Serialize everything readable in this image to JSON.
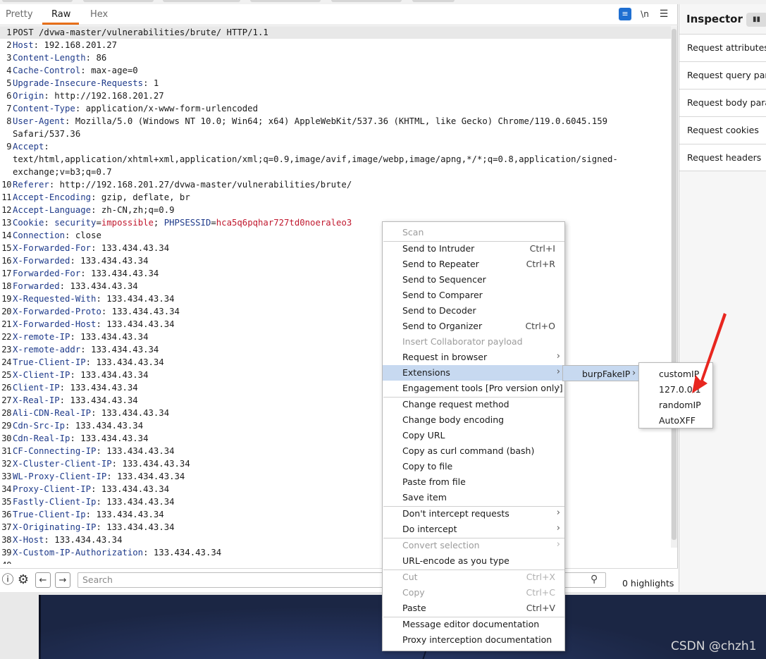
{
  "tabs": [
    {
      "label": "Pretty"
    },
    {
      "label": "Raw"
    },
    {
      "label": "Hex"
    }
  ],
  "toolbar": {
    "wrap_icon": "wrap-lines-icon",
    "newline_label": "\\n",
    "menu_icon": "hamburger-menu-icon"
  },
  "request_lines": [
    {
      "num": "1",
      "key": "",
      "value": "POST /dvwa-master/vulnerabilities/brute/ HTTP/1.1"
    },
    {
      "num": "2",
      "key": "Host",
      "value": "192.168.201.27"
    },
    {
      "num": "3",
      "key": "Content-Length",
      "value": "86"
    },
    {
      "num": "4",
      "key": "Cache-Control",
      "value": "max-age=0"
    },
    {
      "num": "5",
      "key": "Upgrade-Insecure-Requests",
      "value": "1"
    },
    {
      "num": "6",
      "key": "Origin",
      "value": "http://192.168.201.27"
    },
    {
      "num": "7",
      "key": "Content-Type",
      "value": "application/x-www-form-urlencoded"
    },
    {
      "num": "8",
      "key": "User-Agent",
      "value": "Mozilla/5.0 (Windows NT 10.0; Win64; x64) AppleWebKit/537.36 (KHTML, like Gecko) Chrome/119.0.6045.159"
    },
    {
      "num": "",
      "key": "",
      "value": "Safari/537.36"
    },
    {
      "num": "9",
      "key": "Accept",
      "value": ""
    },
    {
      "num": "",
      "key": "",
      "value": "text/html,application/xhtml+xml,application/xml;q=0.9,image/avif,image/webp,image/apng,*/*;q=0.8,application/signed-"
    },
    {
      "num": "",
      "key": "",
      "value": "exchange;v=b3;q=0.7"
    },
    {
      "num": "10",
      "key": "Referer",
      "value": "http://192.168.201.27/dvwa-master/vulnerabilities/brute/"
    },
    {
      "num": "11",
      "key": "Accept-Encoding",
      "value": "gzip, deflate, br"
    },
    {
      "num": "12",
      "key": "Accept-Language",
      "value": "zh-CN,zh;q=0.9"
    },
    {
      "num": "13",
      "key": "Cookie",
      "value": "",
      "cookies": [
        {
          "k": "security",
          "v": "impossible"
        },
        {
          "k": "PHPSESSID",
          "v": "hca5q6pqhar727td0noeraleo3"
        }
      ]
    },
    {
      "num": "14",
      "key": "Connection",
      "value": "close"
    },
    {
      "num": "15",
      "key": "X-Forwarded-For",
      "value": "133.434.43.34"
    },
    {
      "num": "16",
      "key": "X-Forwarded",
      "value": "133.434.43.34"
    },
    {
      "num": "17",
      "key": "Forwarded-For",
      "value": "133.434.43.34"
    },
    {
      "num": "18",
      "key": "Forwarded",
      "value": "133.434.43.34"
    },
    {
      "num": "19",
      "key": "X-Requested-With",
      "value": "133.434.43.34"
    },
    {
      "num": "20",
      "key": "X-Forwarded-Proto",
      "value": "133.434.43.34"
    },
    {
      "num": "21",
      "key": "X-Forwarded-Host",
      "value": "133.434.43.34"
    },
    {
      "num": "22",
      "key": "X-remote-IP",
      "value": "133.434.43.34"
    },
    {
      "num": "23",
      "key": "X-remote-addr",
      "value": "133.434.43.34"
    },
    {
      "num": "24",
      "key": "True-Client-IP",
      "value": "133.434.43.34"
    },
    {
      "num": "25",
      "key": "X-Client-IP",
      "value": "133.434.43.34"
    },
    {
      "num": "26",
      "key": "Client-IP",
      "value": "133.434.43.34"
    },
    {
      "num": "27",
      "key": "X-Real-IP",
      "value": "133.434.43.34"
    },
    {
      "num": "28",
      "key": "Ali-CDN-Real-IP",
      "value": "133.434.43.34"
    },
    {
      "num": "29",
      "key": "Cdn-Src-Ip",
      "value": "133.434.43.34"
    },
    {
      "num": "30",
      "key": "Cdn-Real-Ip",
      "value": "133.434.43.34"
    },
    {
      "num": "31",
      "key": "CF-Connecting-IP",
      "value": "133.434.43.34"
    },
    {
      "num": "32",
      "key": "X-Cluster-Client-IP",
      "value": "133.434.43.34"
    },
    {
      "num": "33",
      "key": "WL-Proxy-Client-IP",
      "value": "133.434.43.34"
    },
    {
      "num": "34",
      "key": "Proxy-Client-IP",
      "value": "133.434.43.34"
    },
    {
      "num": "35",
      "key": "Fastly-Client-Ip",
      "value": "133.434.43.34"
    },
    {
      "num": "36",
      "key": "True-Client-Ip",
      "value": "133.434.43.34"
    },
    {
      "num": "37",
      "key": "X-Originating-IP",
      "value": "133.434.43.34"
    },
    {
      "num": "38",
      "key": "X-Host",
      "value": "133.434.43.34"
    },
    {
      "num": "39",
      "key": "X-Custom-IP-Authorization",
      "value": "133.434.43.34"
    },
    {
      "num": "40",
      "key": "",
      "value": ""
    }
  ],
  "search": {
    "placeholder": "Search",
    "highlights": "0 highlights"
  },
  "inspector": {
    "title": "Inspector",
    "items": [
      {
        "label": "Request attributes"
      },
      {
        "label": "Request query parameters"
      },
      {
        "label": "Request body parameters"
      },
      {
        "label": "Request cookies"
      },
      {
        "label": "Request headers"
      }
    ]
  },
  "context_menu": {
    "items": [
      {
        "label": "Scan",
        "shortcut": "",
        "disabled": true,
        "submenu": false
      },
      {
        "label": "Send to Intruder",
        "shortcut": "Ctrl+I",
        "disabled": false,
        "submenu": false
      },
      {
        "label": "Send to Repeater",
        "shortcut": "Ctrl+R",
        "disabled": false,
        "submenu": false
      },
      {
        "label": "Send to Sequencer",
        "shortcut": "",
        "disabled": false,
        "submenu": false
      },
      {
        "label": "Send to Comparer",
        "shortcut": "",
        "disabled": false,
        "submenu": false
      },
      {
        "label": "Send to Decoder",
        "shortcut": "",
        "disabled": false,
        "submenu": false
      },
      {
        "label": "Send to Organizer",
        "shortcut": "Ctrl+O",
        "disabled": false,
        "submenu": false
      },
      {
        "label": "Insert Collaborator payload",
        "shortcut": "",
        "disabled": true,
        "submenu": false
      },
      {
        "label": "Request in browser",
        "shortcut": "",
        "disabled": false,
        "submenu": true
      },
      {
        "label": "Extensions",
        "shortcut": "",
        "disabled": false,
        "submenu": true,
        "highlighted": true
      },
      {
        "label": "Engagement tools [Pro version only]",
        "shortcut": "",
        "disabled": false,
        "submenu": true
      },
      {
        "label": "Change request method",
        "shortcut": "",
        "disabled": false,
        "submenu": false
      },
      {
        "label": "Change body encoding",
        "shortcut": "",
        "disabled": false,
        "submenu": false
      },
      {
        "label": "Copy URL",
        "shortcut": "",
        "disabled": false,
        "submenu": false
      },
      {
        "label": "Copy as curl command (bash)",
        "shortcut": "",
        "disabled": false,
        "submenu": false
      },
      {
        "label": "Copy to file",
        "shortcut": "",
        "disabled": false,
        "submenu": false
      },
      {
        "label": "Paste from file",
        "shortcut": "",
        "disabled": false,
        "submenu": false
      },
      {
        "label": "Save item",
        "shortcut": "",
        "disabled": false,
        "submenu": false
      },
      {
        "label": "Don't intercept requests",
        "shortcut": "",
        "disabled": false,
        "submenu": true
      },
      {
        "label": "Do intercept",
        "shortcut": "",
        "disabled": false,
        "submenu": true
      },
      {
        "label": "Convert selection",
        "shortcut": "",
        "disabled": true,
        "submenu": true
      },
      {
        "label": "URL-encode as you type",
        "shortcut": "",
        "disabled": false,
        "submenu": false
      },
      {
        "label": "Cut",
        "shortcut": "Ctrl+X",
        "disabled": true,
        "submenu": false
      },
      {
        "label": "Copy",
        "shortcut": "Ctrl+C",
        "disabled": true,
        "submenu": false
      },
      {
        "label": "Paste",
        "shortcut": "Ctrl+V",
        "disabled": false,
        "submenu": false
      },
      {
        "label": "Message editor documentation",
        "shortcut": "",
        "disabled": false,
        "submenu": false
      },
      {
        "label": "Proxy interception documentation",
        "shortcut": "",
        "disabled": false,
        "submenu": false
      }
    ]
  },
  "extensions_submenu": {
    "label": "burpFakeIP"
  },
  "fakeip_submenu": {
    "items": [
      {
        "label": "customIP"
      },
      {
        "label": "127.0.0.1"
      },
      {
        "label": "randomIP"
      },
      {
        "label": "AutoXFF"
      }
    ]
  },
  "annotation": {
    "arrow_color": "#e8261f"
  },
  "watermark": "CSDN @chzh1",
  "colors": {
    "tab_accent": "#e8701a",
    "header_key": "#1e3a8a",
    "cookie_value": "#c0182e",
    "menu_highlight": "#c7d9f0"
  }
}
